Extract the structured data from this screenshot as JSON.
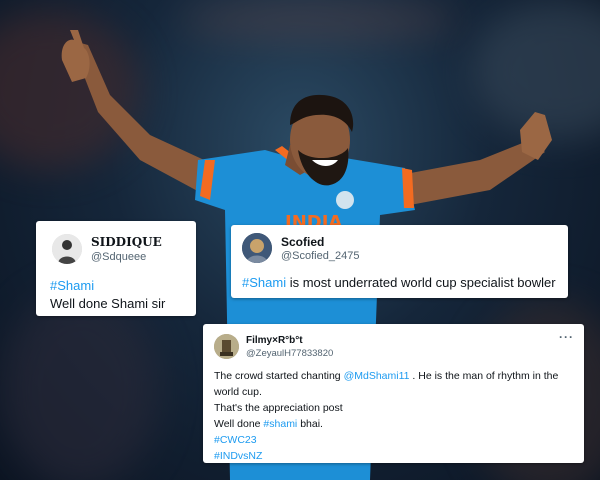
{
  "background": {
    "jersey_color": "#1d8fd6",
    "jersey_text": "INDIA"
  },
  "tweets": [
    {
      "name": "SIDDIQUE",
      "handle": "@Sdqueee",
      "hashtag": "#Shami",
      "text": "Well done Shami sir"
    },
    {
      "name": "Scofied",
      "handle": "@Scofied_2475",
      "hashtag": "#Shami",
      "text": " is most underrated world cup specialist bowler"
    },
    {
      "name": "Filmy×R°b°t",
      "handle": "@ZeyaulH77833820",
      "more": "···",
      "line1_pre": "The crowd started chanting ",
      "mention": "@MdShami11",
      "line1_post": " . He is the man of rhythm in the",
      "line2": "world cup.",
      "line3": "That's the appreciation post",
      "line4_pre": "Well done ",
      "line4_tag": "#shami",
      "line4_post": " bhai.",
      "tag1": "#CWC23",
      "tag2": "#INDvsNZ"
    }
  ],
  "link_color": "#1d9bf0"
}
